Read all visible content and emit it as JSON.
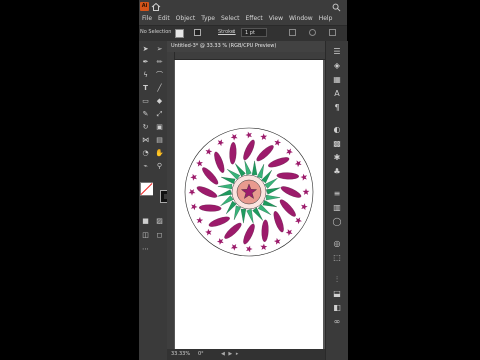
{
  "app": {
    "logo_text": "Ai"
  },
  "menu": [
    "File",
    "Edit",
    "Object",
    "Type",
    "Select",
    "Effect",
    "View",
    "Window",
    "Help"
  ],
  "control_bar": {
    "selection": "No Selection",
    "stroke_label": "Stroke:",
    "stroke_weight": "1 pt"
  },
  "document": {
    "tab_title": "Untitled-3* @ 33.33 % (RGB/CPU Preview)",
    "close_glyph": "×"
  },
  "status": {
    "zoom": "33.33%",
    "rotation": "0°"
  },
  "icons": {
    "menubar": [
      "home-icon",
      "search-icon"
    ],
    "tools": [
      "selection-tool-icon",
      "direct-selection-tool-icon",
      "pen-tool-icon",
      "curvature-tool-icon",
      "type-tool-icon",
      "line-tool-icon",
      "rectangle-tool-icon",
      "paintbrush-tool-icon",
      "pencil-tool-icon",
      "eraser-tool-icon",
      "rotate-tool-icon",
      "scale-tool-icon",
      "width-tool-icon",
      "free-transform-tool-icon",
      "shape-builder-tool-icon",
      "gradient-tool-icon",
      "eyedropper-tool-icon",
      "blend-tool-icon",
      "artboard-tool-icon",
      "hand-tool-icon",
      "zoom-tool-icon"
    ],
    "panels": [
      "properties-icon",
      "layers-icon",
      "libraries-icon",
      "color-icon",
      "swatches-icon",
      "brushes-icon",
      "symbols-icon",
      "stroke-icon",
      "gradient-icon",
      "transparency-icon",
      "appearance-icon",
      "graphic-styles-icon",
      "align-icon",
      "transform-icon",
      "pathfinder-icon",
      "character-icon",
      "paragraph-icon",
      "links-icon"
    ]
  },
  "colors": {
    "accent": "#d4541a",
    "magenta": "#9c1b6b",
    "green": "#1e9a5e",
    "pink": "#e89a8f",
    "canvas": "#575757",
    "chrome": "#3c3c3c"
  }
}
